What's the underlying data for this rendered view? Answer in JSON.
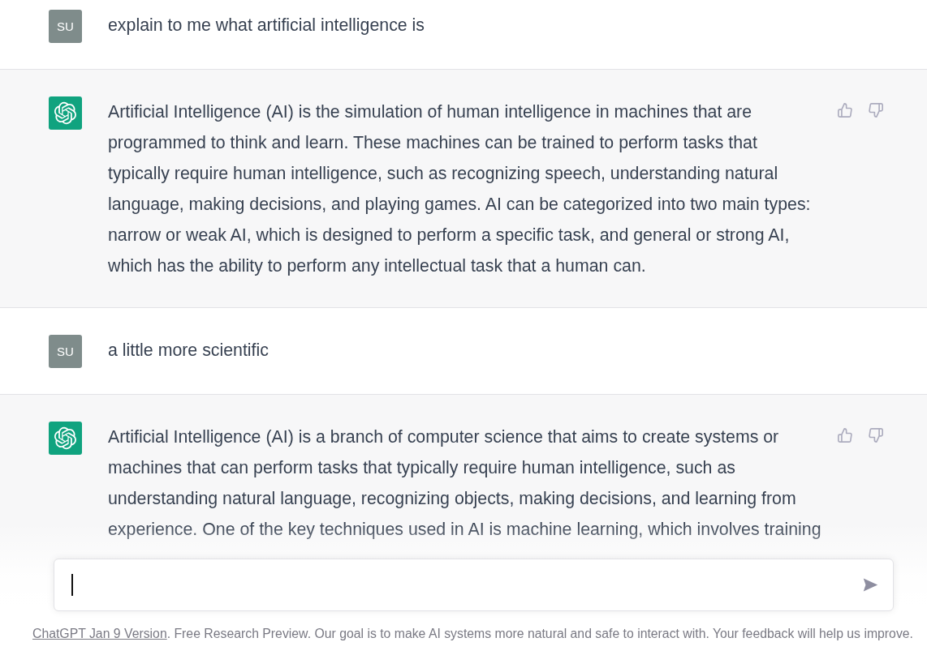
{
  "messages": [
    {
      "kind": "user",
      "avatar": "SU",
      "text": "explain to me what artificial intelligence is"
    },
    {
      "kind": "assistant",
      "text": "Artificial Intelligence (AI) is the simulation of human intelligence in machines that are programmed to think and learn. These machines can be trained to perform tasks that typically require human intelligence, such as recognizing speech, understanding natural language, making decisions, and playing games. AI can be categorized into two main types: narrow or weak AI, which is designed to perform a specific task, and general or strong AI, which has the ability to perform any intellectual task that a human can."
    },
    {
      "kind": "user",
      "avatar": "SU",
      "text": "a little more scientific"
    },
    {
      "kind": "assistant",
      "text": "Artificial Intelligence (AI) is a branch of computer science that aims to create systems or machines that can perform tasks that typically require human intelligence, such as understanding natural language, recognizing objects, making decisions, and learning from experience. One of the key techniques used in AI is machine learning, which involves training"
    }
  ],
  "composer": {
    "focused": true
  },
  "footer": {
    "link": "ChatGPT Jan 9 Version",
    "text": ". Free Research Preview. Our goal is to make AI systems more natural and safe to interact with. Your feedback will help us improve."
  }
}
